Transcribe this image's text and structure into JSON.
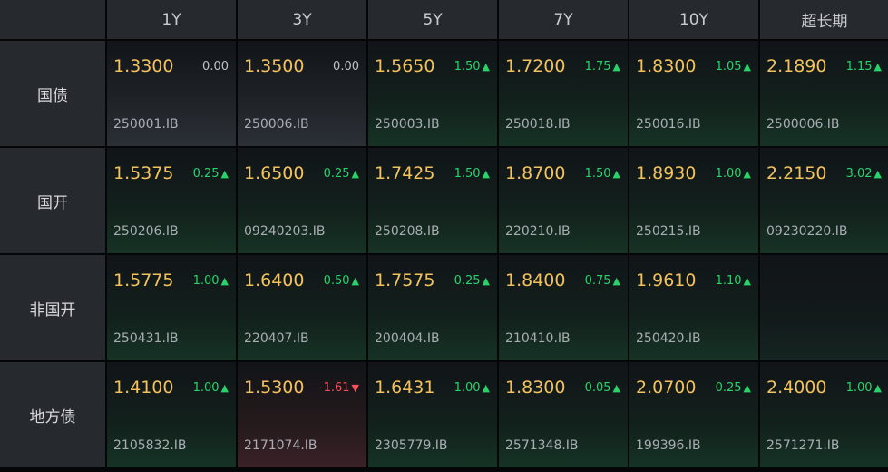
{
  "headers": [
    "1Y",
    "3Y",
    "5Y",
    "7Y",
    "10Y",
    "超长期"
  ],
  "rows": [
    {
      "label": "国债",
      "cells": [
        {
          "price": "1.3300",
          "change": "0.00",
          "dir": "flat",
          "code": "250001.IB",
          "tone": "neutral"
        },
        {
          "price": "1.3500",
          "change": "0.00",
          "dir": "flat",
          "code": "250006.IB",
          "tone": "neutral"
        },
        {
          "price": "1.5650",
          "change": "1.50",
          "dir": "up",
          "code": "250003.IB",
          "tone": "up"
        },
        {
          "price": "1.7200",
          "change": "1.75",
          "dir": "up",
          "code": "250018.IB",
          "tone": "up"
        },
        {
          "price": "1.8300",
          "change": "1.05",
          "dir": "up",
          "code": "250016.IB",
          "tone": "up"
        },
        {
          "price": "2.1890",
          "change": "1.15",
          "dir": "up",
          "code": "2500006.IB",
          "tone": "up"
        }
      ]
    },
    {
      "label": "国开",
      "cells": [
        {
          "price": "1.5375",
          "change": "0.25",
          "dir": "up",
          "code": "250206.IB",
          "tone": "up"
        },
        {
          "price": "1.6500",
          "change": "0.25",
          "dir": "up",
          "code": "09240203.IB",
          "tone": "up"
        },
        {
          "price": "1.7425",
          "change": "1.50",
          "dir": "up",
          "code": "250208.IB",
          "tone": "up"
        },
        {
          "price": "1.8700",
          "change": "1.50",
          "dir": "up",
          "code": "220210.IB",
          "tone": "up"
        },
        {
          "price": "1.8930",
          "change": "1.00",
          "dir": "up",
          "code": "250215.IB",
          "tone": "up"
        },
        {
          "price": "2.2150",
          "change": "3.02",
          "dir": "up",
          "code": "09230220.IB",
          "tone": "up"
        }
      ]
    },
    {
      "label": "非国开",
      "cells": [
        {
          "price": "1.5775",
          "change": "1.00",
          "dir": "up",
          "code": "250431.IB",
          "tone": "up"
        },
        {
          "price": "1.6400",
          "change": "0.50",
          "dir": "up",
          "code": "220407.IB",
          "tone": "up"
        },
        {
          "price": "1.7575",
          "change": "0.25",
          "dir": "up",
          "code": "200404.IB",
          "tone": "up"
        },
        {
          "price": "1.8400",
          "change": "0.75",
          "dir": "up",
          "code": "210410.IB",
          "tone": "up"
        },
        {
          "price": "1.9610",
          "change": "1.10",
          "dir": "up",
          "code": "250420.IB",
          "tone": "up"
        },
        {
          "price": "",
          "change": "",
          "dir": "none",
          "code": "",
          "tone": "empty"
        }
      ]
    },
    {
      "label": "地方债",
      "cells": [
        {
          "price": "1.4100",
          "change": "1.00",
          "dir": "up",
          "code": "2105832.IB",
          "tone": "up"
        },
        {
          "price": "1.5300",
          "change": "-1.61",
          "dir": "down",
          "code": "2171074.IB",
          "tone": "down"
        },
        {
          "price": "1.6431",
          "change": "1.00",
          "dir": "up",
          "code": "2305779.IB",
          "tone": "up"
        },
        {
          "price": "1.8300",
          "change": "0.05",
          "dir": "up",
          "code": "2571348.IB",
          "tone": "up"
        },
        {
          "price": "2.0700",
          "change": "0.25",
          "dir": "up",
          "code": "199396.IB",
          "tone": "up"
        },
        {
          "price": "2.4000",
          "change": "1.00",
          "dir": "up",
          "code": "2571271.IB",
          "tone": "up"
        }
      ]
    }
  ],
  "arrows": {
    "up": "▲",
    "down": "▼"
  },
  "colors": {
    "price": "#f4c25d",
    "up": "#28d36b",
    "down": "#ff4d5e",
    "header_bg": "#26292d"
  }
}
